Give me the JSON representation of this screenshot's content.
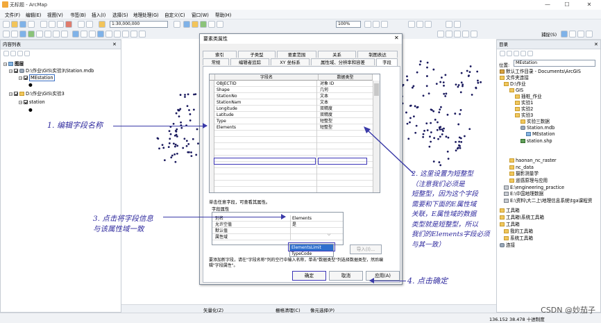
{
  "window": {
    "title": "无标题 - ArcMap",
    "minimize": "—",
    "maximize": "☐",
    "close": "✕"
  },
  "menu": [
    "文件(F)",
    "编辑(E)",
    "视图(V)",
    "书签(B)",
    "插入(I)",
    "选择(S)",
    "地理处理(G)",
    "自定义(C)",
    "窗口(W)",
    "帮助(H)"
  ],
  "toolbar": {
    "scale": "1:30,000,000",
    "zoom_percent": "100%",
    "capture_label": "捕捉(S)"
  },
  "toc": {
    "title": "内容列表",
    "layers_label": "图层",
    "group1": "D:\\作业\\GIS\\实验3\\Station.mdb",
    "layer1": "MEstation",
    "group2": "D:\\作业\\GIS\\实验3",
    "layer2": "station"
  },
  "catalog": {
    "title": "目录",
    "location_label": "位置:",
    "location_value": "MEstation",
    "items": [
      "默认工作目录 - Documents\\ArcGIS",
      "文件夹连接",
      "D:\\作业",
      "GIS",
      "插桩_作业",
      "实验1",
      "实验2",
      "实验3",
      "实验三数据",
      "Station.mdb",
      "MEstation",
      "station.shp",
      "haonan_nc_raster",
      "nc_data",
      "摄影测量学",
      "遥感原理与应用",
      "E:\\engineering_practice",
      "E:\\中国地理数据",
      "E:\\资料\\大二上\\地理信息系统\\tga课程资",
      "工具箱",
      "工具箱\\系统工具箱",
      "工具箱",
      "我的工具箱",
      "系统工具箱",
      "连接"
    ]
  },
  "dialog": {
    "title": "要素类属性",
    "tabs_row1": [
      "索引",
      "子类型",
      "要素范围",
      "关系",
      "制图表达"
    ],
    "tabs_row2": [
      "常规",
      "编辑者追踪",
      "XY 坐标系",
      "属性域、分辨率和容差",
      "字段"
    ],
    "active_tab": "字段",
    "col_name": "字段名",
    "col_type": "数据类型",
    "fields": [
      {
        "name": "OBJECTID",
        "type": "对象 ID"
      },
      {
        "name": "Shape",
        "type": "几何"
      },
      {
        "name": "StationNo",
        "type": "文本"
      },
      {
        "name": "StationNam",
        "type": "文本"
      },
      {
        "name": "Longitude",
        "type": "双精度"
      },
      {
        "name": "Latitude",
        "type": "双精度"
      },
      {
        "name": "Type",
        "type": "短整型"
      },
      {
        "name": "Elements",
        "type": "短整型"
      }
    ],
    "click_hint": "单击任意字段，可查看其属性。",
    "field_props_label": "字段属性",
    "props": [
      {
        "key": "别名",
        "value": "Elements"
      },
      {
        "key": "允许空值",
        "value": "是"
      },
      {
        "key": "默认值",
        "value": ""
      },
      {
        "key": "属性域",
        "value": ""
      }
    ],
    "domain_options": [
      "ElementsLimit",
      "TypeCode"
    ],
    "import_button": "导入(I)...",
    "add_hint": "要添加新字段，请在\"字段名称\"列的空行中输入名称，单击\"数据类型\"列选择数据类型，然后编辑\"字段属性\"。",
    "ok": "确定",
    "cancel": "取消",
    "apply": "应用(A)"
  },
  "annotations": {
    "a1": "1. 编辑字段名称",
    "a2_lines": [
      "2. 这里设置为短整型",
      "（注意我们必须是",
      "短整型，因为这个字段",
      "需要和下面的E属性域",
      "关联，E属性域的数据",
      "类型就是短整型，所以",
      "我们的Elements字段必须",
      "与其一致）"
    ],
    "a3_lines": [
      "3. 点击将字段信息",
      "与该属性域一致"
    ],
    "a4": "4. 点击确定"
  },
  "bottom_toolbar": {
    "vectorize": "矢量化(Z)",
    "raster_clean": "栅格清理(C)",
    "pixel_select": "像元选择(P)"
  },
  "status": {
    "coords": "136.152  38.478 十进制度"
  },
  "watermark": "CSDN @妙茄子"
}
